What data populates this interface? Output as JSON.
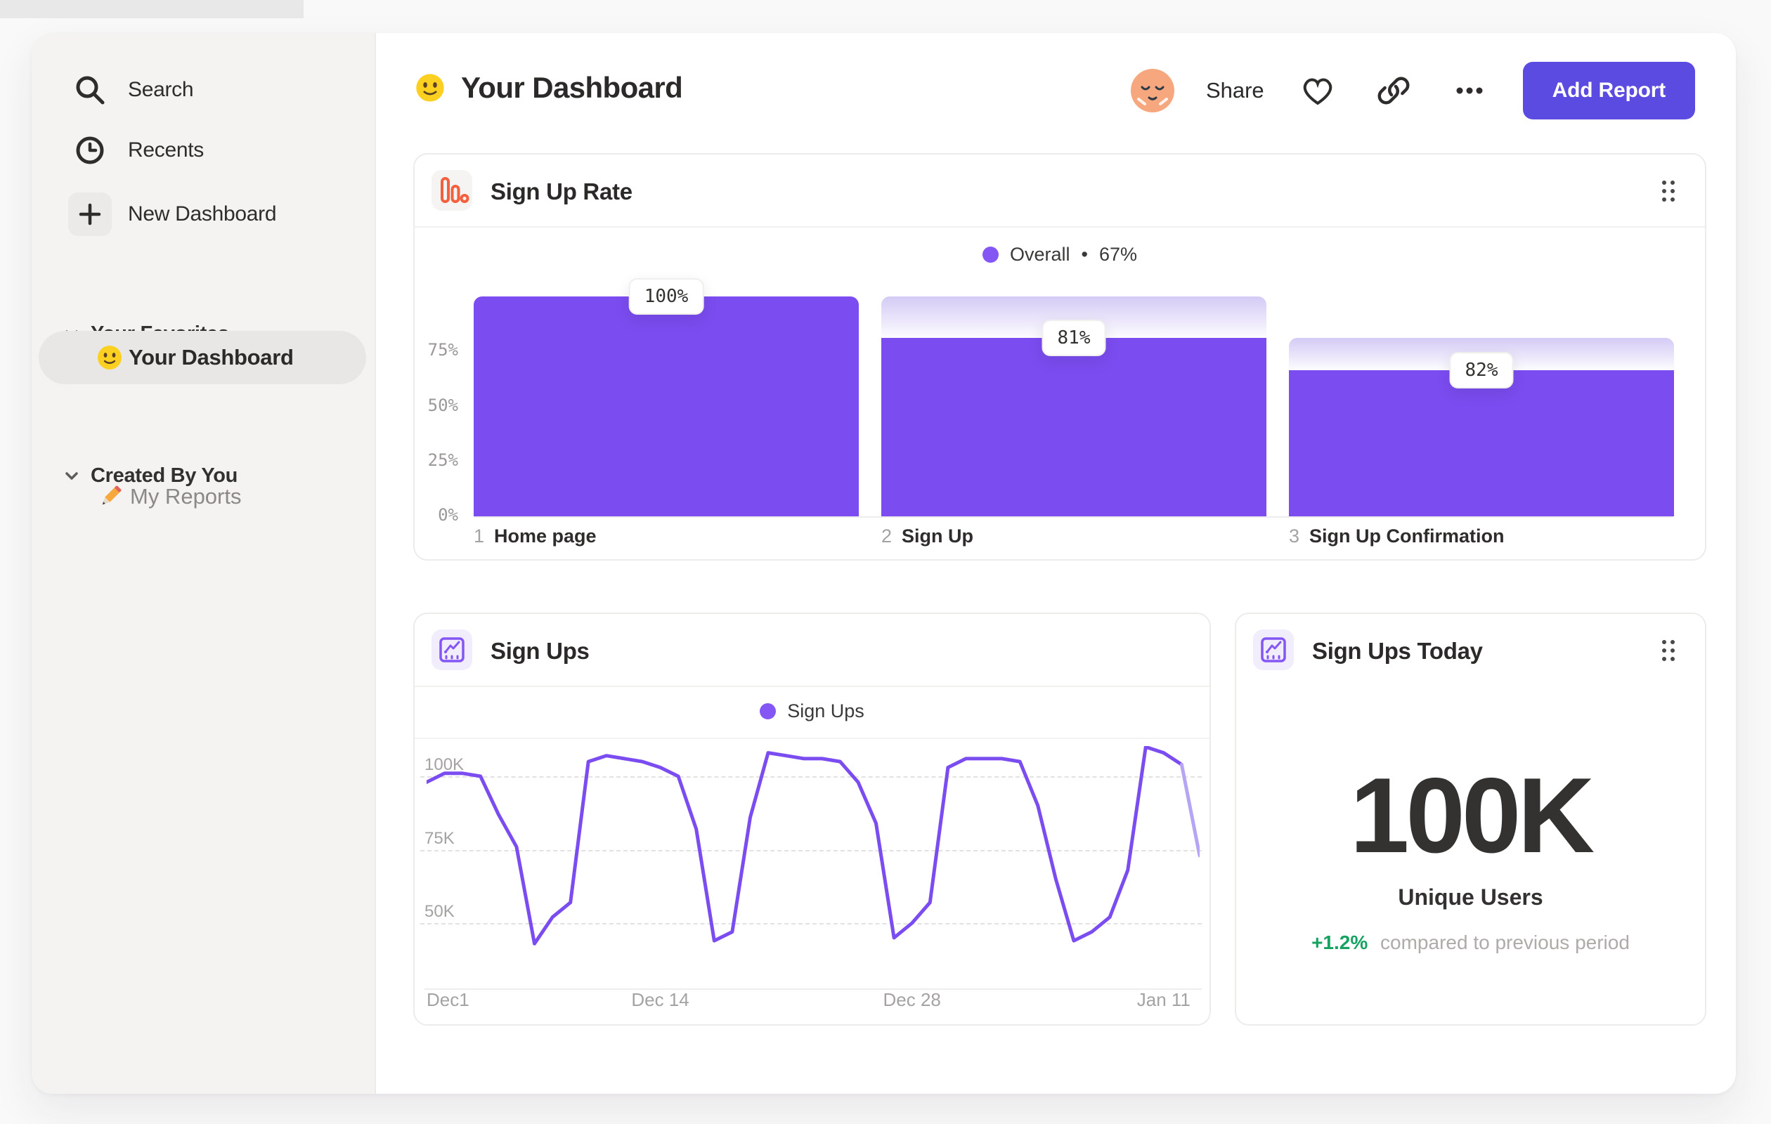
{
  "colors": {
    "accent": "#7b4cf0",
    "accent_faded": "#b6a4f4",
    "button": "#5b4be1",
    "icon_orange": "#f2603d",
    "green": "#17a262"
  },
  "sidebar": {
    "items": [
      {
        "icon": "search-icon",
        "label": "Search"
      },
      {
        "icon": "clock-icon",
        "label": "Recents"
      },
      {
        "icon": "plus-icon",
        "label": "New Dashboard"
      }
    ],
    "sections": [
      {
        "header": "Your Favorites"
      },
      {
        "header": "Created By You"
      }
    ],
    "favorite_item": {
      "label": "Your Dashboard",
      "selected": true
    },
    "reports_item": {
      "label": "My Reports"
    }
  },
  "header": {
    "title": "Your Dashboard",
    "share_label": "Share",
    "add_report_label": "Add Report"
  },
  "cards": {
    "funnel": {
      "title": "Sign Up Rate"
    },
    "line": {
      "title": "Sign Ups"
    },
    "stat": {
      "title": "Sign Ups Today",
      "value": "100K",
      "unit_label": "Unique Users",
      "delta": "+1.2%",
      "delta_text": "compared to previous period"
    }
  },
  "chart_data": [
    {
      "type": "bar",
      "variant": "funnel",
      "title": "Sign Up Rate",
      "legend": [
        {
          "label": "Overall",
          "separator": "•",
          "value": "67%"
        }
      ],
      "ylim": [
        0,
        100
      ],
      "y_ticks": [
        {
          "label": "75%",
          "value": 75
        },
        {
          "label": "50%",
          "value": 50
        },
        {
          "label": "25%",
          "value": 25
        },
        {
          "label": "0%",
          "value": 0
        }
      ],
      "steps": [
        {
          "index": "1",
          "label": "Home page",
          "conversion_label": "100%",
          "overall_pct": 100,
          "prev_overall_pct": null
        },
        {
          "index": "2",
          "label": "Sign Up",
          "conversion_label": "81%",
          "overall_pct": 81,
          "prev_overall_pct": 100
        },
        {
          "index": "3",
          "label": "Sign Up Confirmation",
          "conversion_label": "82%",
          "overall_pct": 66.4,
          "prev_overall_pct": 81
        }
      ]
    },
    {
      "type": "line",
      "title": "Sign Ups",
      "legend": [
        {
          "label": "Sign Ups"
        }
      ],
      "unit": "K",
      "x_range_days": [
        0,
        43
      ],
      "x_ticks": [
        {
          "label": "Dec1",
          "day": 0
        },
        {
          "label": "Dec 14",
          "day": 13
        },
        {
          "label": "Dec 28",
          "day": 27
        },
        {
          "label": "Jan 11",
          "day": 41
        }
      ],
      "y_ticks": [
        {
          "label": "100K",
          "value": 100
        },
        {
          "label": "75K",
          "value": 75
        },
        {
          "label": "50K",
          "value": 50
        }
      ],
      "values": [
        98,
        101,
        101,
        100,
        87,
        76,
        43,
        52,
        57,
        105,
        107,
        106,
        105,
        103,
        100,
        82,
        44,
        47,
        86,
        108,
        107,
        106,
        106,
        105,
        98,
        84,
        45,
        50,
        57,
        103,
        106,
        106,
        106,
        105,
        90,
        65,
        44,
        47,
        52,
        68,
        110,
        108,
        104,
        73
      ],
      "faded_tail_points": 1
    },
    {
      "type": "stat",
      "title": "Sign Ups Today",
      "value": "100K",
      "label": "Unique Users",
      "delta": "+1.2%",
      "delta_text": "compared to previous period"
    }
  ]
}
